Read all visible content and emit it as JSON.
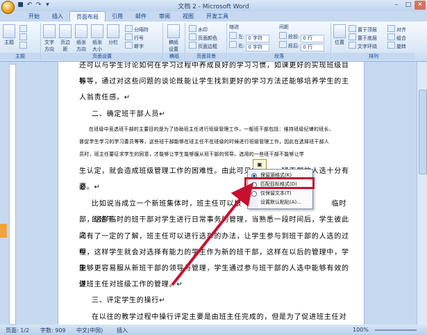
{
  "window": {
    "title": "文档 2 - Microsoft Word"
  },
  "tabs": [
    "开始",
    "插入",
    "页面布局",
    "引用",
    "邮件",
    "审阅",
    "视图",
    "开发工具"
  ],
  "active_tab": "页面布局",
  "ribbon": {
    "theme_group": {
      "label": "主题",
      "buttons": [
        "主题"
      ]
    },
    "page_setup": {
      "label": "页面设置",
      "buttons": [
        "文字方向",
        "页边距",
        "纸张方向",
        "纸张大小",
        "分栏"
      ],
      "small": [
        "分隔符",
        "行号",
        "断字"
      ]
    },
    "draft": {
      "label": "稿纸",
      "buttons": [
        "稿纸设置"
      ]
    },
    "page_bg": {
      "label": "页面背景",
      "small": [
        "水印",
        "页面颜色",
        "页面边框"
      ]
    },
    "paragraph": {
      "label": "段落",
      "indent": "缩进",
      "spacing": "间距",
      "left_label": "左:",
      "right_label": "右:",
      "before_label": "段前:",
      "after_label": "段后:",
      "left_val": "0 字符",
      "right_val": "0 字符",
      "before_val": "0 行",
      "after_val": "0 行"
    },
    "arrange": {
      "label": "排列",
      "buttons": [
        "位置"
      ],
      "small": [
        "置于顶层",
        "置于底层",
        "文字环绕",
        "对齐",
        "组合",
        "旋转"
      ]
    }
  },
  "document": {
    "paragraphs": [
      "还可以与学生讨论如何在学习过程中养成良好的学习习惯，如课更好的实现班级目标",
      "等等，通过对这些问题的谈论既能让学生找到更好的学习方法还能够培养学生的主",
      "人翁责任感。↵",
      "二、确定班干部人员↵",
      "在班级中竞选班干部的主要目的是为了协助班主任进行班级管理工作，一般班干部包括：维持班级纪律的班长、",
      "督促学生学习的学习委员等等，这些班干部能够在班主任不在班级的时候进行班级管理工作，因此在选择班干部人",
      "员时，班主任要征求学生的同意，才能够让学生能够服从班干部的领导。选用的一些班干部不能够让学",
      "生认定，就会造成班级管理工作的困难性。由此可见学　　　班干部的人选十分有必",
      "要。↵",
      "比如说当成立一个新班集体时，班主任可以根　　　　　　　　　　　　临时的班干",
      "部，这样临时的班干部对学生进行日常事务的管理，当熟悉一段时间后，学生彼此之",
      "间有了一定的了解，班主任可以进行选举的办法，让学生参与到班干部的人选的过程",
      "中，这样学生就会对选择有能力的学生作为新的班干部，这样在以后的管理中，学生",
      "能够更容易服从新班干部的领导与管理，学生通过参与班干部的人选中能够有效的促",
      "进班主任对班级工作的管理。↵",
      "三、评定学生的操行↵",
      "在以往的教学过程中操行评定主要是由班主任完成的，但是为了促进班主任对学"
    ]
  },
  "paste_menu": {
    "items": [
      "保留源格式(K)",
      "匹配目标格式(D)",
      "仅保留文本(T)",
      "设置默认粘贴(A)..."
    ],
    "selected_index": 0
  },
  "status": {
    "page": "页面: 1/2",
    "words": "字数: 909",
    "lang": "中文(中国)",
    "mode": "插入",
    "zoom": "100%"
  }
}
